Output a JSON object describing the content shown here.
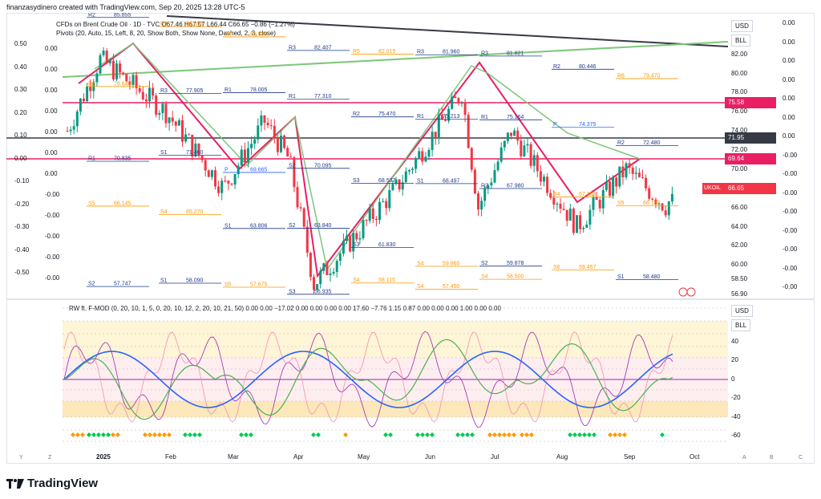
{
  "header": {
    "caption": "finanzasydinero created with TradingView.com, Sep 20, 2025 13:28 UTC-5"
  },
  "legend": {
    "line1": "CFDs on Brent Crude Oil · 1D · TVC  O67.46  H67.57  L66.44  C66.65  −0.86 (−1.27%)",
    "line2": "Pivots (20, Auto, 15, Left, 8, 20, Show Both, Show None, Dashed, 2, 3, close)"
  },
  "osc_legend": "RW ft. F-MOD (0, 20, 10, 1, 5, 0, 20, 10, 12, 2, 20, 10, 21, 50)  0.00  0.00  −17.02  0.00  0.00  0.00  0.00  17.60  −7.76  1.15  0.87  0.00  0.00  0.00  1.00  0.00  0.00",
  "buttons": {
    "currency": "USD",
    "unit": "BLL",
    "currency2": "USD",
    "unit2": "BLL"
  },
  "right_axis_labels": [
    "82.00",
    "80.00",
    "78.00",
    "76.00",
    "74.00",
    "72.00",
    "70.00",
    "68.00",
    "66.00",
    "64.00",
    "62.00",
    "60.00",
    "58.50",
    "56.90"
  ],
  "outer_axis_labels": [
    "0.00",
    "0.00",
    "0.00",
    "0.00",
    "0.00",
    "0.00",
    "0.00",
    "-0.00",
    "-0.00",
    "-0.00",
    "-0.00",
    "-0.00",
    "-0.00",
    "-0.00",
    "-0.00"
  ],
  "left_axis_labels": [
    "0.50",
    "0.40",
    "0.30",
    "0.20",
    "0.10",
    "0.00",
    "-0.10",
    "-0.20",
    "-0.30",
    "-0.40",
    "-0.50"
  ],
  "left_axis_labels_inner": [
    "0.00",
    "0.00",
    "0.00",
    "0.00",
    "0.00",
    "0.00",
    "0.00",
    "-0.00",
    "-0.00",
    "-0.00",
    "-0.00",
    "-0.00"
  ],
  "price_tags": [
    {
      "text": "75.58",
      "color": "#e91e63"
    },
    {
      "text": "71.95",
      "color": "#363a45"
    },
    {
      "text": "69.64",
      "color": "#e91e63"
    },
    {
      "text": "66.65",
      "color": "#f23645"
    }
  ],
  "symbol_tag": "UKOIL",
  "osc_axis_labels": [
    "40",
    "20",
    "0",
    "-20",
    "-40",
    "-60"
  ],
  "x_axis_labels": [
    "2025",
    "Feb",
    "Mar",
    "Apr",
    "May",
    "Jun",
    "Jul",
    "Aug",
    "Sep",
    "Oct"
  ],
  "corner_letters": [
    "Y",
    "Z",
    "A",
    "B",
    "C"
  ],
  "pivot_labels": [
    {
      "t": "R2",
      "v": "85.855"
    },
    {
      "t": "R4",
      "v": "84.895"
    },
    {
      "t": "R4",
      "v": "83.830"
    },
    {
      "t": "R3",
      "v": "82.407"
    },
    {
      "t": "R5",
      "v": "82.015"
    },
    {
      "t": "R3",
      "v": "81.960"
    },
    {
      "t": "R3",
      "v": "81.821"
    },
    {
      "t": "R2",
      "v": "80.446"
    },
    {
      "t": "R6",
      "v": "79.470"
    },
    {
      "t": "R5",
      "v": "78.645"
    },
    {
      "t": "R3",
      "v": "77.905"
    },
    {
      "t": "R1",
      "v": "78.005"
    },
    {
      "t": "R1",
      "v": "77.310"
    },
    {
      "t": "R2",
      "v": "75.470"
    },
    {
      "t": "R1",
      "v": "75.213"
    },
    {
      "t": "R1",
      "v": "75.164"
    },
    {
      "t": "P",
      "v": "74.375"
    },
    {
      "t": "R2",
      "v": "72.480"
    },
    {
      "t": "R1",
      "v": "70.835"
    },
    {
      "t": "S1",
      "v": "71.460"
    },
    {
      "t": "P",
      "v": "69.665"
    },
    {
      "t": "S2",
      "v": "70.095"
    },
    {
      "t": "S3",
      "v": "68.537"
    },
    {
      "t": "S1",
      "v": "68.497"
    },
    {
      "t": "R2",
      "v": "67.980"
    },
    {
      "t": "S4",
      "v": "67.106"
    },
    {
      "t": "S5",
      "v": "66.183"
    },
    {
      "t": "S5",
      "v": "66.145"
    },
    {
      "t": "S4",
      "v": "65.270"
    },
    {
      "t": "S1",
      "v": "63.806"
    },
    {
      "t": "S2",
      "v": "63.840"
    },
    {
      "t": "S3",
      "v": "61.830"
    },
    {
      "t": "S4",
      "v": "59.865"
    },
    {
      "t": "S2",
      "v": "59.878"
    },
    {
      "t": "S6",
      "v": "59.467"
    },
    {
      "t": "S1",
      "v": "58.480"
    },
    {
      "t": "S2",
      "v": "57.747"
    },
    {
      "t": "S1",
      "v": "58.090"
    },
    {
      "t": "S5",
      "v": "57.675"
    },
    {
      "t": "S3",
      "v": "56.935"
    },
    {
      "t": "S4",
      "v": "58.115"
    },
    {
      "t": "S4",
      "v": "57.450"
    },
    {
      "t": "S4",
      "v": "58.500"
    }
  ],
  "colors": {
    "red": "#f23645",
    "green": "#089981",
    "pink": "#e91e63",
    "navy": "#1e3a8a",
    "blue": "#2962ff",
    "orange": "#ff9800",
    "lightgreen": "#7cc77a",
    "black": "#363a45"
  },
  "branding": "TradingView"
}
